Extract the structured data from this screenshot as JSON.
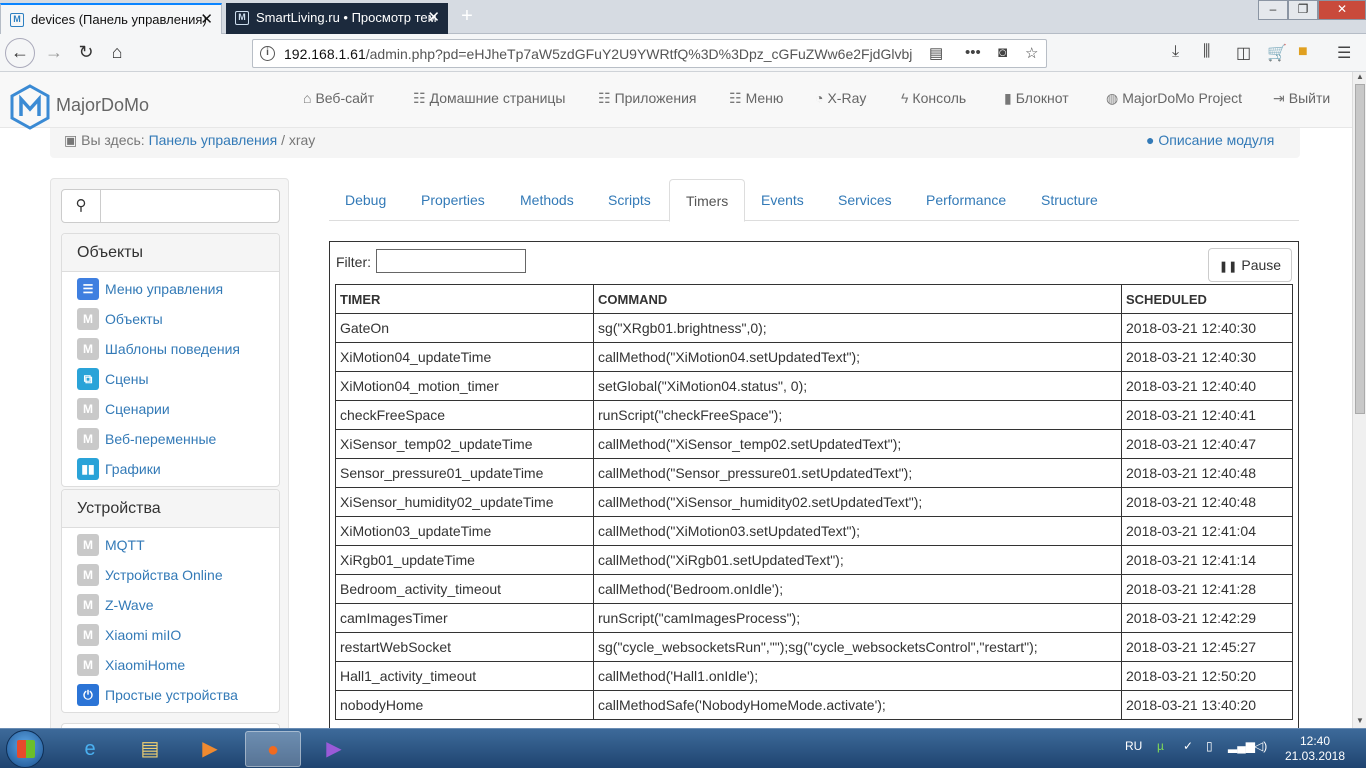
{
  "browser": {
    "tabs": [
      {
        "title": "devices (Панель управления)",
        "active": true
      },
      {
        "title": "SmartLiving.ru • Просмотр тем",
        "active": false
      }
    ],
    "new_tab": "+",
    "close": "✕",
    "url_host": "192.168.1.61",
    "url_path": "/admin.php?pd=eHJheTp7aW5zdGFuY2U9YWRtfQ%3D%3Dpz_cGFuZWw6e2FjdGlvbj"
  },
  "header": {
    "brand": "MajorDoMo",
    "menu": [
      {
        "icon": "home-icon",
        "label": "Веб-сайт"
      },
      {
        "icon": "list-icon",
        "label": "Домашние страницы"
      },
      {
        "icon": "grid-icon",
        "label": "Приложения"
      },
      {
        "icon": "grid-icon",
        "label": "Меню"
      },
      {
        "icon": "dashboard-icon",
        "label": "X-Ray"
      },
      {
        "icon": "bolt-icon",
        "label": "Консоль"
      },
      {
        "icon": "notebook-icon",
        "label": "Блокнот"
      },
      {
        "icon": "globe-icon",
        "label": "MajorDoMo Project"
      },
      {
        "icon": "logout-icon",
        "label": "Выйти"
      }
    ]
  },
  "breadcrumb": {
    "prefix": "Вы здесь:",
    "link": "Панель управления",
    "separator": "/",
    "current": "xray",
    "help": "Описание модуля"
  },
  "sidebar": {
    "sections": [
      {
        "title": "Объекты",
        "items": [
          {
            "label": "Меню управления",
            "icon": "menu-icon",
            "color": "#3f7fe0"
          },
          {
            "label": "Объекты",
            "icon": "module-icon",
            "color": "#c9c9c9"
          },
          {
            "label": "Шаблоны поведения",
            "icon": "module-icon",
            "color": "#c9c9c9"
          },
          {
            "label": "Сцены",
            "icon": "scenes-icon",
            "color": "#2aa3d8"
          },
          {
            "label": "Сценарии",
            "icon": "module-icon",
            "color": "#c9c9c9"
          },
          {
            "label": "Веб-переменные",
            "icon": "module-icon",
            "color": "#c9c9c9"
          },
          {
            "label": "Графики",
            "icon": "chart-icon",
            "color": "#2aa3d8"
          }
        ]
      },
      {
        "title": "Устройства",
        "items": [
          {
            "label": "MQTT",
            "icon": "module-icon",
            "color": "#c9c9c9"
          },
          {
            "label": "Устройства Online",
            "icon": "module-icon",
            "color": "#c9c9c9"
          },
          {
            "label": "Z-Wave",
            "icon": "module-icon",
            "color": "#c9c9c9"
          },
          {
            "label": "Xiaomi miIO",
            "icon": "module-icon",
            "color": "#c9c9c9"
          },
          {
            "label": "XiaomiHome",
            "icon": "module-icon",
            "color": "#c9c9c9"
          },
          {
            "label": "Простые устройства",
            "icon": "power-icon",
            "color": "#2b74d6"
          }
        ]
      }
    ]
  },
  "tabs": [
    "Debug",
    "Properties",
    "Methods",
    "Scripts",
    "Timers",
    "Events",
    "Services",
    "Performance",
    "Structure"
  ],
  "active_tab": "Timers",
  "timers": {
    "filter_label": "Filter:",
    "filter_value": "",
    "pause_label": "Pause",
    "columns": [
      "TIMER",
      "COMMAND",
      "SCHEDULED"
    ],
    "rows": [
      [
        "GateOn",
        "sg(\"XRgb01.brightness\",0);",
        "2018-03-21 12:40:30"
      ],
      [
        "XiMotion04_updateTime",
        "callMethod(\"XiMotion04.setUpdatedText\");",
        "2018-03-21 12:40:30"
      ],
      [
        "XiMotion04_motion_timer",
        "setGlobal(\"XiMotion04.status\", 0);",
        "2018-03-21 12:40:40"
      ],
      [
        "checkFreeSpace",
        "runScript(\"checkFreeSpace\");",
        "2018-03-21 12:40:41"
      ],
      [
        "XiSensor_temp02_updateTime",
        "callMethod(\"XiSensor_temp02.setUpdatedText\");",
        "2018-03-21 12:40:47"
      ],
      [
        "Sensor_pressure01_updateTime",
        "callMethod(\"Sensor_pressure01.setUpdatedText\");",
        "2018-03-21 12:40:48"
      ],
      [
        "XiSensor_humidity02_updateTime",
        "callMethod(\"XiSensor_humidity02.setUpdatedText\");",
        "2018-03-21 12:40:48"
      ],
      [
        "XiMotion03_updateTime",
        "callMethod(\"XiMotion03.setUpdatedText\");",
        "2018-03-21 12:41:04"
      ],
      [
        "XiRgb01_updateTime",
        "callMethod(\"XiRgb01.setUpdatedText\");",
        "2018-03-21 12:41:14"
      ],
      [
        "Bedroom_activity_timeout",
        "callMethod('Bedroom.onIdle');",
        "2018-03-21 12:41:28"
      ],
      [
        "camImagesTimer",
        "runScript(\"camImagesProcess\");",
        "2018-03-21 12:42:29"
      ],
      [
        "restartWebSocket",
        "sg(\"cycle_websocketsRun\",\"\");sg(\"cycle_websocketsControl\",\"restart\");",
        "2018-03-21 12:45:27"
      ],
      [
        "Hall1_activity_timeout",
        "callMethod('Hall1.onIdle');",
        "2018-03-21 12:50:20"
      ],
      [
        "nobodyHome",
        "callMethodSafe('NobodyHomeMode.activate');",
        "2018-03-21 13:40:20"
      ]
    ]
  },
  "taskbar": {
    "lang": "RU",
    "time": "12:40",
    "date": "21.03.2018"
  },
  "colors": {
    "link": "#337ab7",
    "accent_tab": "#0a84ff",
    "taskbar": "#1f4470"
  }
}
